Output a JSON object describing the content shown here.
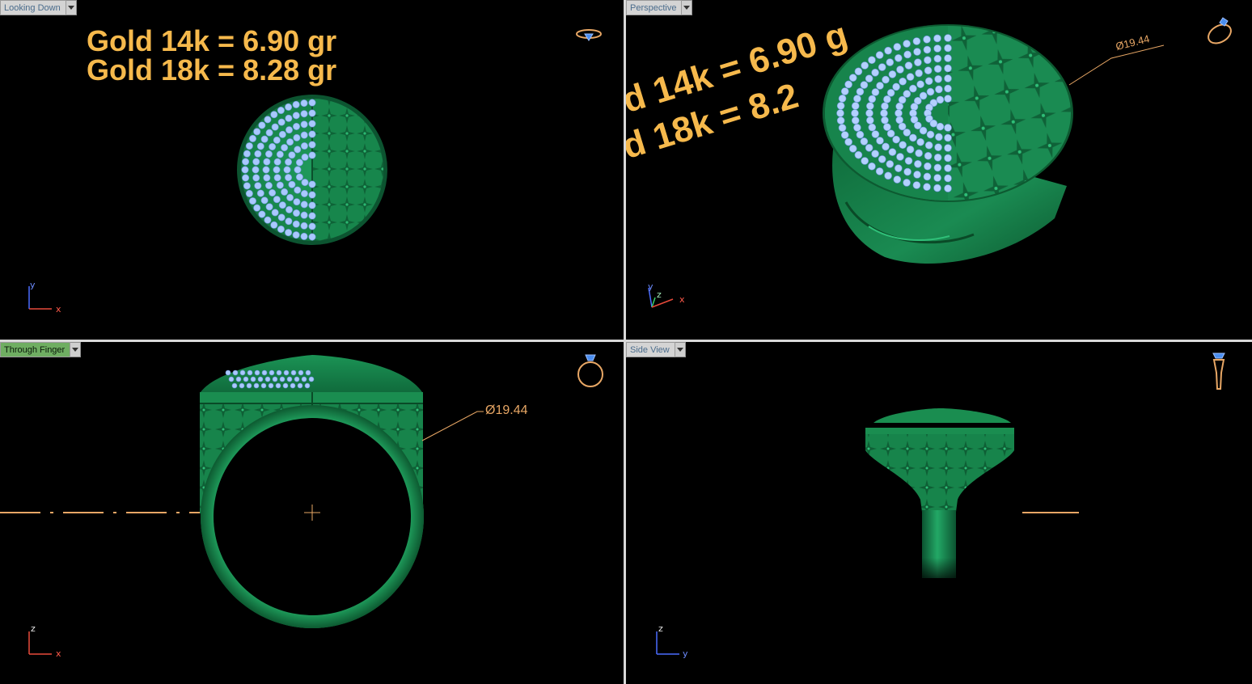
{
  "viewports": {
    "top_left": {
      "label": "Looking Down",
      "axes": {
        "h": "x",
        "v": "y"
      }
    },
    "top_right": {
      "label": "Perspective",
      "axes": {
        "h": "x",
        "v": "y",
        "d": "z"
      }
    },
    "bottom_left": {
      "label": "Through Finger",
      "axes": {
        "h": "x",
        "v": "z"
      }
    },
    "bottom_right": {
      "label": "Side View",
      "axes": {
        "h": "y",
        "v": "z"
      }
    }
  },
  "weights": {
    "gold14": "Gold 14k = 6.90 gr",
    "gold18": "Gold 18k = 8.28 gr",
    "persp14": "d 14k = 6.90 g",
    "persp18": "d 18k = 8.2"
  },
  "dimension": "Ø19.44",
  "colors": {
    "ring_green": "#1c8f56",
    "ring_dark": "#0b4f2c",
    "stone_blue": "#a9c8ff",
    "weight_text": "#f6b94c",
    "annotation": "#e8a765",
    "active_tab": "#6fae62"
  },
  "icons": [
    "ring-top-icon",
    "ring-perspective-icon",
    "ring-front-icon",
    "ring-side-icon"
  ]
}
